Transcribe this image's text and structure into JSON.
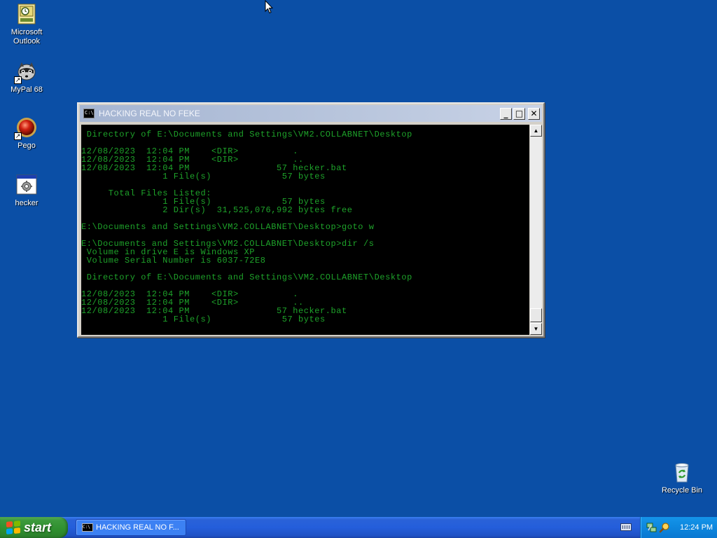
{
  "desktop": {
    "icons": [
      {
        "label": "Microsoft Outlook",
        "icon": "outlook-icon"
      },
      {
        "label": "MyPal 68",
        "icon": "mypal-raccoon-icon"
      },
      {
        "label": "Pego",
        "icon": "pego-red-orb-icon"
      },
      {
        "label": "hecker",
        "icon": "batch-file-icon"
      },
      {
        "label": "Recycle Bin",
        "icon": "recycle-bin-icon"
      }
    ]
  },
  "window": {
    "title": "HACKING REAL NO FEKE",
    "icon_text": "C:\\",
    "buttons": {
      "minimize": "_",
      "maximize": "□",
      "close": "✕"
    },
    "console_lines": [
      " Directory of E:\\Documents and Settings\\VM2.COLLABNET\\Desktop",
      "",
      "12/08/2023  12:04 PM    <DIR>          .",
      "12/08/2023  12:04 PM    <DIR>          ..",
      "12/08/2023  12:04 PM                57 hecker.bat",
      "               1 File(s)             57 bytes",
      "",
      "     Total Files Listed:",
      "               1 File(s)             57 bytes",
      "               2 Dir(s)  31,525,076,992 bytes free",
      "",
      "E:\\Documents and Settings\\VM2.COLLABNET\\Desktop>goto w",
      "",
      "E:\\Documents and Settings\\VM2.COLLABNET\\Desktop>dir /s",
      " Volume in drive E is Windows XP",
      " Volume Serial Number is 6037-72E8",
      "",
      " Directory of E:\\Documents and Settings\\VM2.COLLABNET\\Desktop",
      "",
      "12/08/2023  12:04 PM    <DIR>          .",
      "12/08/2023  12:04 PM    <DIR>          ..",
      "12/08/2023  12:04 PM                57 hecker.bat",
      "               1 File(s)             57 bytes"
    ],
    "scroll_up": "▲",
    "scroll_down": "▼"
  },
  "taskbar": {
    "start_label": "start",
    "task_label": "HACKING REAL NO F...",
    "task_icon_text": "C:\\",
    "clock": "12:24 PM"
  },
  "colors": {
    "desktop": "#0b4fa6",
    "console_text": "#1ea32a",
    "console_bg": "#000000",
    "taskbar": "#245edb",
    "start_green": "#3c9a3c",
    "tray": "#0e8ae0"
  }
}
